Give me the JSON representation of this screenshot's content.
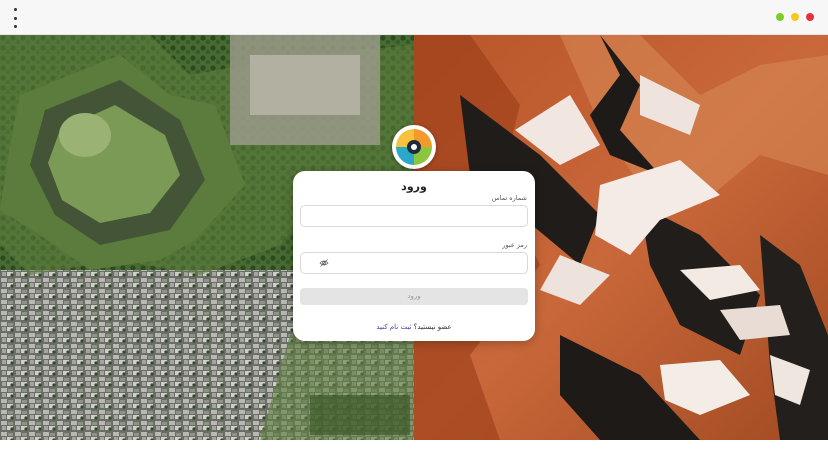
{
  "window": {
    "control_colors": [
      "#e6323c",
      "#f4c81e",
      "#7ccd28"
    ]
  },
  "login": {
    "title": "ورود",
    "phone_label": "شماره تماس",
    "phone_value": "",
    "password_label": "رمز عبور",
    "password_value": "",
    "submit_label": "ورود",
    "signup_prompt": "عضو نیستید؟",
    "signup_link": "ثبت نام کنید"
  },
  "icons": {
    "menu": "kebab-menu-icon",
    "logo": "aperture-logo-icon",
    "password_toggle": "eye-off-icon"
  },
  "colors": {
    "link": "#4a3aa8",
    "disabled_button": "#e4e4e4"
  }
}
